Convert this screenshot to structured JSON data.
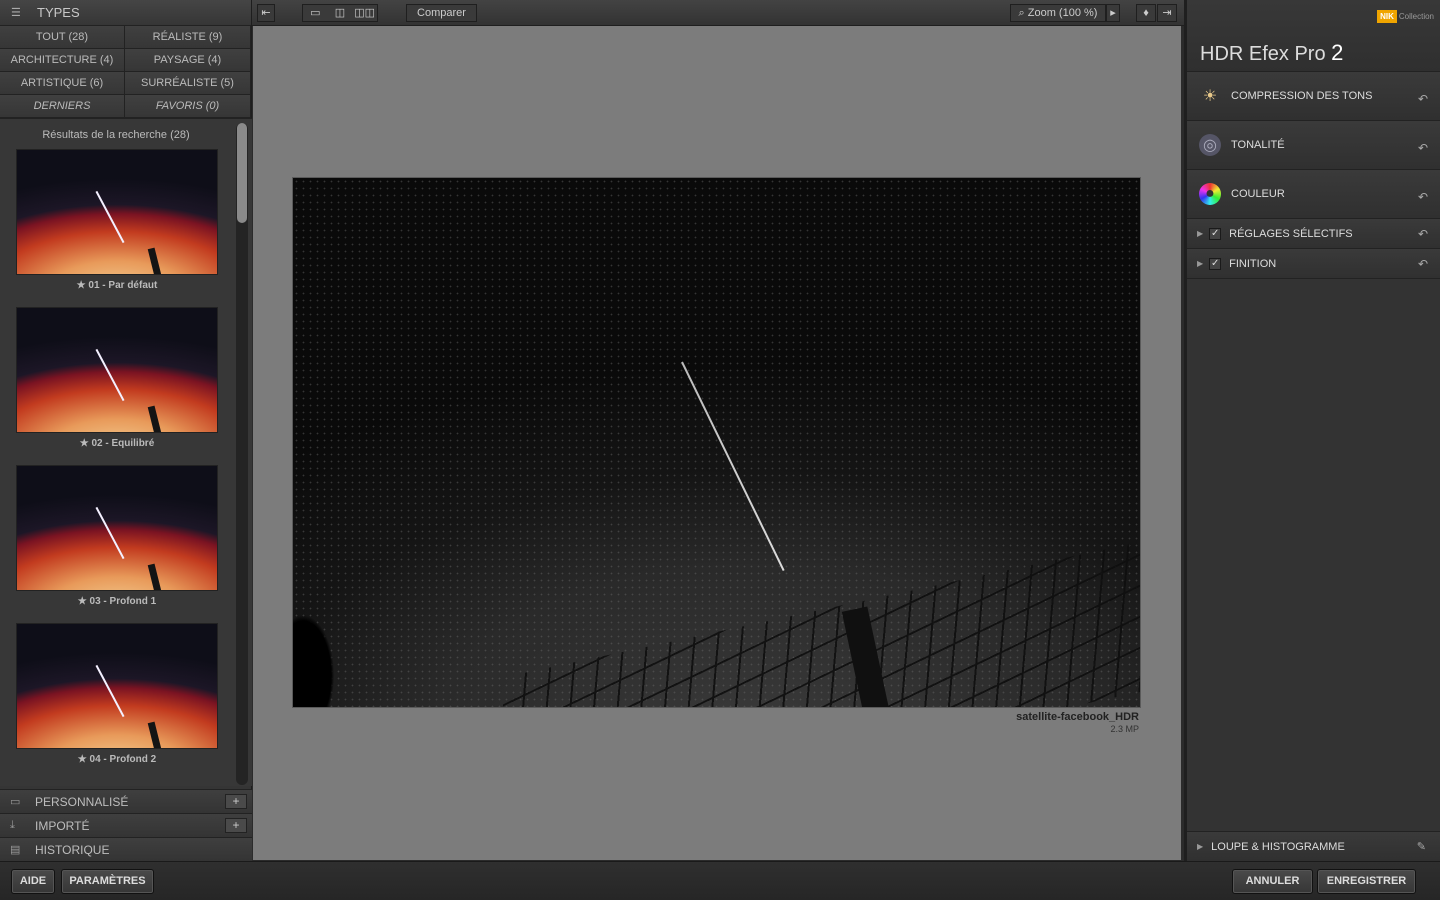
{
  "left": {
    "header": "TYPES",
    "categories": [
      "TOUT (28)",
      "RÉALISTE (9)",
      "ARCHITECTURE (4)",
      "PAYSAGE (4)",
      "ARTISTIQUE (6)",
      "SURRÉALISTE (5)",
      "DERNIERS",
      "FAVORIS (0)"
    ],
    "results_label": "Résultats de la recherche (28)",
    "presets": [
      "01 - Par défaut",
      "02 - Equilibré",
      "03 - Profond 1",
      "04 - Profond 2"
    ],
    "sections": [
      "PERSONNALISÉ",
      "IMPORTÉ",
      "HISTORIQUE"
    ]
  },
  "toolbar": {
    "compare": "Comparer",
    "zoom": "Zoom (100 %)"
  },
  "image": {
    "filename": "satellite-facebook_HDR",
    "size": "2.3 MP"
  },
  "right": {
    "brand": "Collection",
    "brand_mark": "NIK",
    "title": "HDR Efex Pro",
    "version": "2",
    "sections": [
      "COMPRESSION DES TONS",
      "TONALITÉ",
      "COULEUR"
    ],
    "checked_sections": [
      "RÉGLAGES SÉLECTIFS",
      "FINITION"
    ],
    "loupe": "LOUPE & HISTOGRAMME"
  },
  "bottom": {
    "help": "AIDE",
    "settings": "PARAMÈTRES",
    "cancel": "ANNULER",
    "save": "ENREGISTRER"
  }
}
